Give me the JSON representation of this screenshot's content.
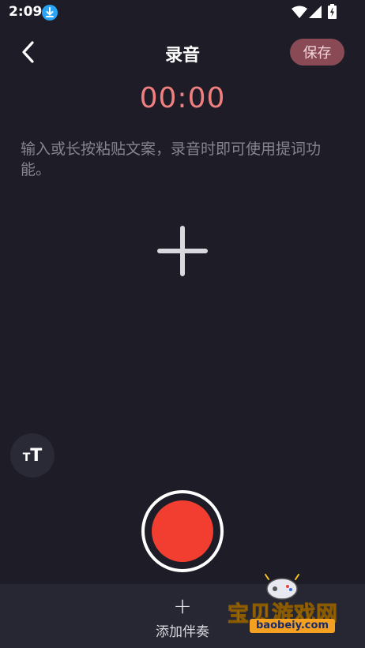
{
  "status_bar": {
    "time": "2:09"
  },
  "header": {
    "title": "录音",
    "save_label": "保存"
  },
  "timer": {
    "value": "00:00"
  },
  "prompt": {
    "placeholder_text": "输入或长按粘贴文案，录音时即可使用提词功能。"
  },
  "bottom": {
    "add_accompaniment_label": "添加伴奏"
  },
  "watermark": {
    "brand": "宝贝游戏网",
    "url": "baobeiy.com"
  },
  "colors": {
    "background": "#1e1d27",
    "timer": "#f08080",
    "record": "#f23e30",
    "save_bg": "#8a4a55"
  }
}
